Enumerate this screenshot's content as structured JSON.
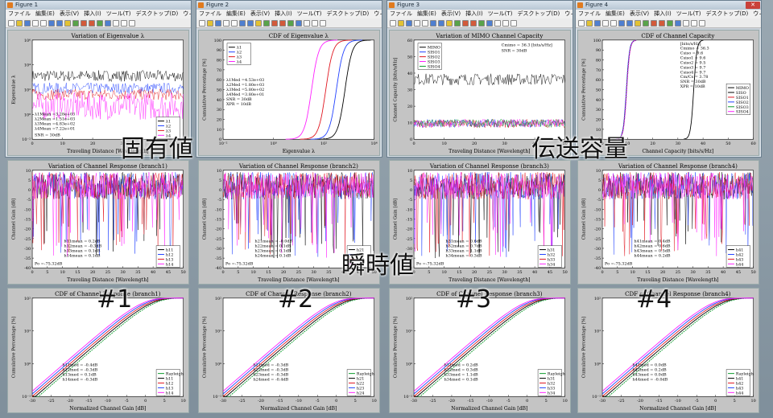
{
  "windows": [
    {
      "title": "Figure 1",
      "menus": [
        "ファイル",
        "編集(E)",
        "表示(V)",
        "挿入(I)",
        "ツール(T)",
        "デスクトップ(D)",
        "ウィンドウ(W)",
        "ヘルプ(H)"
      ]
    },
    {
      "title": "Figure 2",
      "menus": [
        "ファイル",
        "編集(E)",
        "表示(V)",
        "挿入(I)",
        "ツール(T)",
        "デスクトップ(D)",
        "ウィンドウ(W)",
        "ヘルプ(H)"
      ]
    },
    {
      "title": "Figure 3",
      "menus": [
        "ファイル",
        "編集(E)",
        "表示(V)",
        "挿入(I)",
        "ツール(T)",
        "デスクトップ(D)",
        "ウィンドウ(W)",
        "ヘルプ(H)"
      ]
    },
    {
      "title": "Figure 4",
      "menus": [
        "ファイル",
        "編集(E)",
        "表示(V)",
        "挿入(I)",
        "ツール(T)",
        "デスクトップ(D)",
        "ウィンドウ(W)",
        "ヘルプ(H)"
      ]
    }
  ],
  "overlays": {
    "eigen": "固有値",
    "capacity": "伝送容量",
    "instant": "瞬時値",
    "b1": "#1",
    "b2": "#2",
    "b3": "#3",
    "b4": "#4"
  },
  "colors": {
    "black": "#000000",
    "blue": "#1f3fff",
    "red": "#e0141e",
    "magenta": "#ff1eff",
    "green": "#0a9a2a"
  },
  "chart_data": [
    {
      "id": "eig",
      "type": "line",
      "title": "Variation of Eigenvalue λ",
      "xlabel": "Traveling Distance [Wavelength]",
      "ylabel": "Eigenvalue λ",
      "xlim": [
        0,
        50
      ],
      "ylim": [
        -2,
        6
      ],
      "ylog": true,
      "xticks": [
        "0",
        "10",
        "20",
        "30",
        "40",
        "50"
      ],
      "yticks": [
        "10⁻²",
        "10⁰",
        "10²",
        "10⁴",
        "10⁶"
      ],
      "series": [
        {
          "name": "λ1",
          "level": 3.2
        },
        {
          "name": "λ2",
          "level": 2.2
        },
        {
          "name": "λ3",
          "level": 1.7
        },
        {
          "name": "λ4",
          "level": 0.9
        }
      ],
      "annotations": [
        "λ1Mean =3.28e+03",
        "λ2Mean =1.51e+03",
        "λ3Mean =4.83e+02",
        "λ4Mean =7.22e+01",
        "SNR = 30dB"
      ]
    },
    {
      "id": "cdfeig",
      "type": "line",
      "title": "CDF of Eigenvalue λ",
      "xlabel": "Eigenvalue λ",
      "ylabel": "Cumulative Percentage [%]",
      "xlim": [
        -2,
        5
      ],
      "ylim": [
        0,
        100
      ],
      "xticks": [
        "10⁻²",
        "10⁰",
        "10²",
        "10⁴"
      ],
      "yticks": [
        "0",
        "10",
        "20",
        "30",
        "40",
        "50",
        "60",
        "70",
        "80",
        "90",
        "100"
      ],
      "series": [
        {
          "name": "λ1",
          "med": 3.65
        },
        {
          "name": "λ2",
          "med": 3.25
        },
        {
          "name": "λ3",
          "med": 2.76
        },
        {
          "name": "λ4",
          "med": 2.1
        }
      ],
      "annotations": [
        "λ1Med =4.53e+03",
        "λ2Med =1.80e+03",
        "λ3Med =5.80e+02",
        "λ4Med =3.80e+01",
        "SNR = 30dB",
        "XPR = 10dB"
      ]
    },
    {
      "id": "cap",
      "type": "line",
      "title": "Variation of MIMO Channel Capacity",
      "xlabel": "Traveling Distance [Wavelength]",
      "ylabel": "Channel Capacity [bits/s/Hz]",
      "xlim": [
        0,
        50
      ],
      "ylim": [
        0,
        60
      ],
      "xticks": [
        "0",
        "10",
        "20",
        "30",
        "40",
        "50"
      ],
      "yticks": [
        "0",
        "10",
        "20",
        "30",
        "40",
        "50",
        "60"
      ],
      "series": [
        {
          "name": "MIMO",
          "level": 36.3
        },
        {
          "name": "SISO1",
          "level": 9.6
        },
        {
          "name": "SISO2",
          "level": 9.5
        },
        {
          "name": "SISO3",
          "level": 9.7
        },
        {
          "name": "SISO4",
          "level": 9.7
        }
      ],
      "annotations": [
        "Cmimo = 36.3 [bits/s/Hz]",
        "SNR = 30dB"
      ]
    },
    {
      "id": "cdfcap",
      "type": "line",
      "title": "CDF of Channel Capacity",
      "xlabel": "Channel Capacity [bits/s/Hz]",
      "ylabel": "Cumulative Percentage [%]",
      "xlim": [
        0,
        60
      ],
      "ylim": [
        0,
        100
      ],
      "xticks": [
        "0",
        "10",
        "20",
        "30",
        "40",
        "50",
        "60"
      ],
      "yticks": [
        "0",
        "10",
        "20",
        "30",
        "40",
        "50",
        "60",
        "70",
        "80",
        "90",
        "100"
      ],
      "series": [
        {
          "name": "MIMO",
          "med": 36.3
        },
        {
          "name": "SISO",
          "med": 9.6
        },
        {
          "name": "SISO1",
          "med": 9.6
        },
        {
          "name": "SISO2",
          "med": 9.5
        },
        {
          "name": "SISO3",
          "med": 9.7
        },
        {
          "name": "SISO4",
          "med": 9.7
        }
      ],
      "annotations": [
        "[bits/s/Hz]",
        "Cmimo = 36.3",
        "Csiso = 9.6",
        "Csiso1 = 9.6",
        "Csiso2 = 9.5",
        "Csiso3 = 9.7",
        "Csiso4 = 9.7",
        "Cm/Cs = 3.78",
        "SNR = 30dB",
        "XPR = 10dB"
      ]
    },
    {
      "id": "r1",
      "type": "line",
      "title": "Variation of Channel Response (branch1)",
      "xlabel": "Traveling Distance [Wavelength]",
      "ylabel": "Channel Gain [dB]",
      "xlim": [
        0,
        50
      ],
      "ylim": [
        -40,
        10
      ],
      "xticks": [
        "0",
        "5",
        "10",
        "15",
        "20",
        "25",
        "30",
        "35",
        "40",
        "45",
        "50"
      ],
      "yticks": [
        "-40",
        "-35",
        "-30",
        "-25",
        "-20",
        "-15",
        "-10",
        "-5",
        "0",
        "5",
        "10"
      ],
      "series": [
        {
          "name": "h11"
        },
        {
          "name": "h12"
        },
        {
          "name": "h13"
        },
        {
          "name": "h14"
        }
      ],
      "annotations": [
        "h11mean = 0.2dB",
        "h12mean = -0.3dB",
        "h13mean = 0.1dB",
        "h14mean = 0.1dB",
        "Po =-75.32dB"
      ]
    },
    {
      "id": "r2",
      "type": "line",
      "title": "Variation of Channel Response (branch2)",
      "xlabel": "Traveling Distance [Wavelength]",
      "ylabel": "Channel Gain [dB]",
      "xlim": [
        0,
        50
      ],
      "ylim": [
        -40,
        10
      ],
      "xticks": [
        "0",
        "5",
        "10",
        "15",
        "20",
        "25",
        "30",
        "35",
        "40",
        "45",
        "50"
      ],
      "yticks": [
        "-40",
        "-35",
        "-30",
        "-25",
        "-20",
        "-15",
        "-10",
        "-5",
        "0",
        "5",
        "10"
      ],
      "series": [
        {
          "name": "h21"
        },
        {
          "name": "h22"
        },
        {
          "name": "h23"
        },
        {
          "name": "h24"
        }
      ],
      "annotations": [
        "h21mean = -0.0dB",
        "h22mean = 0.1dB",
        "h23mean = 0.1dB",
        "h24mean = 0.1dB",
        "Po =-75.32dB"
      ]
    },
    {
      "id": "r3",
      "type": "line",
      "title": "Variation of Channel Response (branch3)",
      "xlabel": "Traveling Distance [Wavelength]",
      "ylabel": "Channel Gain [dB]",
      "xlim": [
        0,
        50
      ],
      "ylim": [
        -40,
        10
      ],
      "xticks": [
        "0",
        "5",
        "10",
        "15",
        "20",
        "25",
        "30",
        "35",
        "40",
        "45",
        "50"
      ],
      "yticks": [
        "-40",
        "-35",
        "-30",
        "-25",
        "-20",
        "-15",
        "-10",
        "-5",
        "0",
        "5",
        "10"
      ],
      "series": [
        {
          "name": "h31"
        },
        {
          "name": "h32"
        },
        {
          "name": "h33"
        },
        {
          "name": "h34"
        }
      ],
      "annotations": [
        "h31mean = 0.6dB",
        "h32mean = 0.7dB",
        "h33mean = 1.1dB",
        "h34mean = 0.3dB",
        "Po =-75.32dB"
      ]
    },
    {
      "id": "r4",
      "type": "line",
      "title": "Variation of Channel Response (branch4)",
      "xlabel": "Traveling Distance [Wavelength]",
      "ylabel": "Channel Gain [dB]",
      "xlim": [
        0,
        50
      ],
      "ylim": [
        -40,
        10
      ],
      "xticks": [
        "0",
        "5",
        "10",
        "15",
        "20",
        "25",
        "30",
        "35",
        "40",
        "45",
        "50"
      ],
      "yticks": [
        "-40",
        "-35",
        "-30",
        "-25",
        "-20",
        "-15",
        "-10",
        "-5",
        "0",
        "5",
        "10"
      ],
      "series": [
        {
          "name": "h41"
        },
        {
          "name": "h42"
        },
        {
          "name": "h43"
        },
        {
          "name": "h44"
        }
      ],
      "annotations": [
        "h41mean = 0.4dB",
        "h42mean = 0.6dB",
        "h43mean = 0.5dB",
        "h44mean = 0.2dB",
        "Po =-75.32dB"
      ]
    },
    {
      "id": "c1",
      "type": "line",
      "title": "CDF of Channel Response (branch1)",
      "xlabel": "Normalized Channel Gain [dB]",
      "ylabel": "Cumulative Percentage [%]",
      "xlim": [
        -30,
        10
      ],
      "ylim": [
        -1,
        2
      ],
      "ylog": true,
      "xticks": [
        "-30",
        "-25",
        "-20",
        "-15",
        "-10",
        "-5",
        "0",
        "5",
        "10"
      ],
      "yticks": [
        "10⁻¹",
        "10⁰",
        "10¹",
        "10²"
      ],
      "series": [
        {
          "name": "Rayleigh"
        },
        {
          "name": "h11"
        },
        {
          "name": "h12"
        },
        {
          "name": "h13"
        },
        {
          "name": "h14"
        }
      ],
      "annotations": [
        "h11med = -0.4dB",
        "h12med = -0.3dB",
        "h13med = 0.1dB",
        "h14med = -0.3dB"
      ]
    },
    {
      "id": "c2",
      "type": "line",
      "title": "CDF of Channel Response (branch2)",
      "xlabel": "Normalized Channel Gain [dB]",
      "ylabel": "Cumulative Percentage [%]",
      "xlim": [
        -30,
        10
      ],
      "ylim": [
        -1,
        2
      ],
      "ylog": true,
      "xticks": [
        "-30",
        "-25",
        "-20",
        "-15",
        "-10",
        "-5",
        "0",
        "5",
        "10"
      ],
      "yticks": [
        "10⁻¹",
        "10⁰",
        "10¹",
        "10²"
      ],
      "series": [
        {
          "name": "Rayleigh"
        },
        {
          "name": "h21"
        },
        {
          "name": "h22"
        },
        {
          "name": "h23"
        },
        {
          "name": "h24"
        }
      ],
      "annotations": [
        "h21med = -0.3dB",
        "h22med = -0.3dB",
        "h23med = -0.3dB",
        "h24med = -0.4dB"
      ]
    },
    {
      "id": "c3",
      "type": "line",
      "title": "CDF of Channel Response (branch3)",
      "xlabel": "Normalized Channel Gain [dB]",
      "ylabel": "Cumulative Percentage [%]",
      "xlim": [
        -30,
        10
      ],
      "ylim": [
        -1,
        2
      ],
      "ylog": true,
      "xticks": [
        "-30",
        "-25",
        "-20",
        "-15",
        "-10",
        "-5",
        "0",
        "5",
        "10"
      ],
      "yticks": [
        "10⁻¹",
        "10⁰",
        "10¹",
        "10²"
      ],
      "series": [
        {
          "name": "Rayleigh"
        },
        {
          "name": "h31"
        },
        {
          "name": "h32"
        },
        {
          "name": "h33"
        },
        {
          "name": "h34"
        }
      ],
      "annotations": [
        "h31med = 0.2dB",
        "h32med = 0.3dB",
        "h33med = 1.1dB",
        "h34med = 0.1dB"
      ]
    },
    {
      "id": "c4",
      "type": "line",
      "title": "CDF of Channel Response (branch4)",
      "xlabel": "Normalized Channel Gain [dB]",
      "ylabel": "Cumulative Percentage [%]",
      "xlim": [
        -30,
        10
      ],
      "ylim": [
        -1,
        2
      ],
      "ylog": true,
      "xticks": [
        "-30",
        "-25",
        "-20",
        "-15",
        "-10",
        "-5",
        "0",
        "5",
        "10"
      ],
      "yticks": [
        "10⁻¹",
        "10⁰",
        "10¹",
        "10²"
      ],
      "series": [
        {
          "name": "Rayleigh"
        },
        {
          "name": "h41"
        },
        {
          "name": "h42"
        },
        {
          "name": "h43"
        },
        {
          "name": "h44"
        }
      ],
      "annotations": [
        "h41med = 0.0dB",
        "h42med = 0.2dB",
        "h43med = 0.0dB",
        "h44med = -0.0dB"
      ]
    }
  ]
}
